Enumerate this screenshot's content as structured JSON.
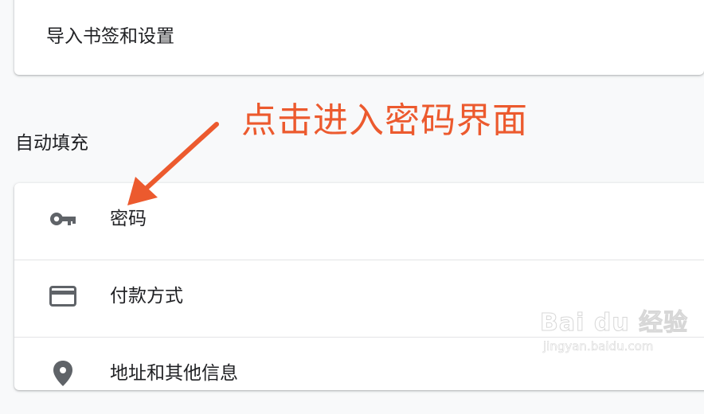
{
  "import_card": {
    "label": "导入书签和设置"
  },
  "autofill": {
    "section_title": "自动填充",
    "items": [
      {
        "label": "密码",
        "icon": "key-icon"
      },
      {
        "label": "付款方式",
        "icon": "credit-card-icon"
      },
      {
        "label": "地址和其他信息",
        "icon": "location-pin-icon"
      }
    ]
  },
  "annotation": {
    "text": "点击进入密码界面",
    "color": "#ec5a2e"
  },
  "watermark": {
    "main": "Bai du 经验",
    "sub": "jingyan.baidu.com"
  },
  "colors": {
    "page_background": "#f8f9fa",
    "card_background": "#ffffff",
    "icon": "#5f6368",
    "text": "#202124"
  }
}
